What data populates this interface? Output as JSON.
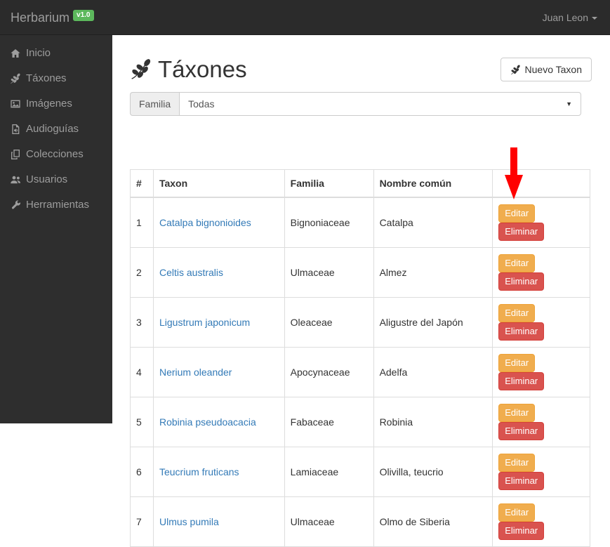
{
  "navbar": {
    "brand": "Herbarium",
    "version_badge": "v1.0",
    "user_menu": "Juan Leon"
  },
  "sidebar": {
    "items": [
      {
        "icon": "home-icon",
        "label": "Inicio"
      },
      {
        "icon": "leaf-icon",
        "label": "Táxones"
      },
      {
        "icon": "image-icon",
        "label": "Imágenes"
      },
      {
        "icon": "audio-file-icon",
        "label": "Audioguías"
      },
      {
        "icon": "collections-icon",
        "label": "Colecciones"
      },
      {
        "icon": "users-icon",
        "label": "Usuarios"
      },
      {
        "icon": "wrench-icon",
        "label": "Herramientas"
      }
    ]
  },
  "main": {
    "title": "Táxones",
    "new_taxon_button": "Nuevo Taxon",
    "filter": {
      "label": "Familia",
      "selected": "Todas"
    },
    "table": {
      "headers": [
        "#",
        "Taxon",
        "Familia",
        "Nombre común",
        ""
      ],
      "actions": {
        "edit": "Editar",
        "delete": "Eliminar"
      },
      "rows": [
        {
          "num": "1",
          "taxon": "Catalpa bignonioides",
          "familia": "Bignoniaceae",
          "nombre_comun": "Catalpa"
        },
        {
          "num": "2",
          "taxon": "Celtis australis",
          "familia": "Ulmaceae",
          "nombre_comun": "Almez"
        },
        {
          "num": "3",
          "taxon": "Ligustrum japonicum",
          "familia": "Oleaceae",
          "nombre_comun": "Aligustre del Japón"
        },
        {
          "num": "4",
          "taxon": "Nerium oleander",
          "familia": "Apocynaceae",
          "nombre_comun": "Adelfa"
        },
        {
          "num": "5",
          "taxon": "Robinia pseudoacacia",
          "familia": "Fabaceae",
          "nombre_comun": "Robinia"
        },
        {
          "num": "6",
          "taxon": "Teucrium fruticans",
          "familia": "Lamiaceae",
          "nombre_comun": "Olivilla, teucrio"
        },
        {
          "num": "7",
          "taxon": "Ulmus pumila",
          "familia": "Ulmaceae",
          "nombre_comun": "Olmo de Siberia"
        }
      ]
    }
  },
  "annotation": {
    "type": "red-arrow",
    "points_at": "row-1-edit-button"
  },
  "colors": {
    "navbar_bg": "#2b2b2b",
    "sidebar_bg": "#2e2e2e",
    "badge_green": "#5cb85c",
    "link_blue": "#337ab7",
    "warning_orange": "#f0ad4e",
    "danger_red": "#d9534f",
    "arrow_red": "#ff0000"
  }
}
